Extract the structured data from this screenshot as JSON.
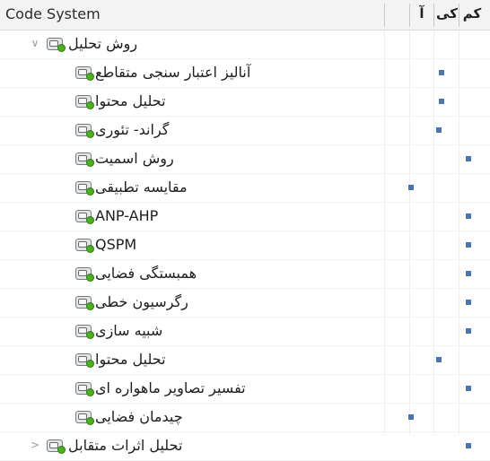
{
  "header": {
    "title": "Code System",
    "col1": "آ",
    "col2": "کی",
    "col3": "کم"
  },
  "colors": {
    "marker": "#4b74b3",
    "code_icon_dot": "#4caf1f"
  },
  "rows": [
    {
      "label": "روش تحلیل",
      "toggle": "∨",
      "col": null
    },
    {
      "label": "آنالیز اعتبار سنجی متقاطع",
      "col": "کی"
    },
    {
      "label": "تحلیل محتوا",
      "col": "کی"
    },
    {
      "label": "گراند- تئوری",
      "col": "کی"
    },
    {
      "label": "روش اسمیت",
      "col": "کم"
    },
    {
      "label": "مقایسه تطبیقی",
      "col": "آ"
    },
    {
      "label": "ANP-AHP",
      "col": "کم"
    },
    {
      "label": "QSPM",
      "col": "کم"
    },
    {
      "label": "همبستگی فضایی",
      "col": "کم"
    },
    {
      "label": "رگرسیون خطی",
      "col": "کم"
    },
    {
      "label": "شبیه سازی",
      "col": "کم"
    },
    {
      "label": "تحلیل محتوا",
      "col": "کی"
    },
    {
      "label": "تفسیر تصاویر ماهواره ای",
      "col": "کم"
    },
    {
      "label": "چیدمان فضایی",
      "col": "آ"
    },
    {
      "label": "تحلیل اثرات متقابل",
      "toggle": ">",
      "col": "کم"
    }
  ]
}
